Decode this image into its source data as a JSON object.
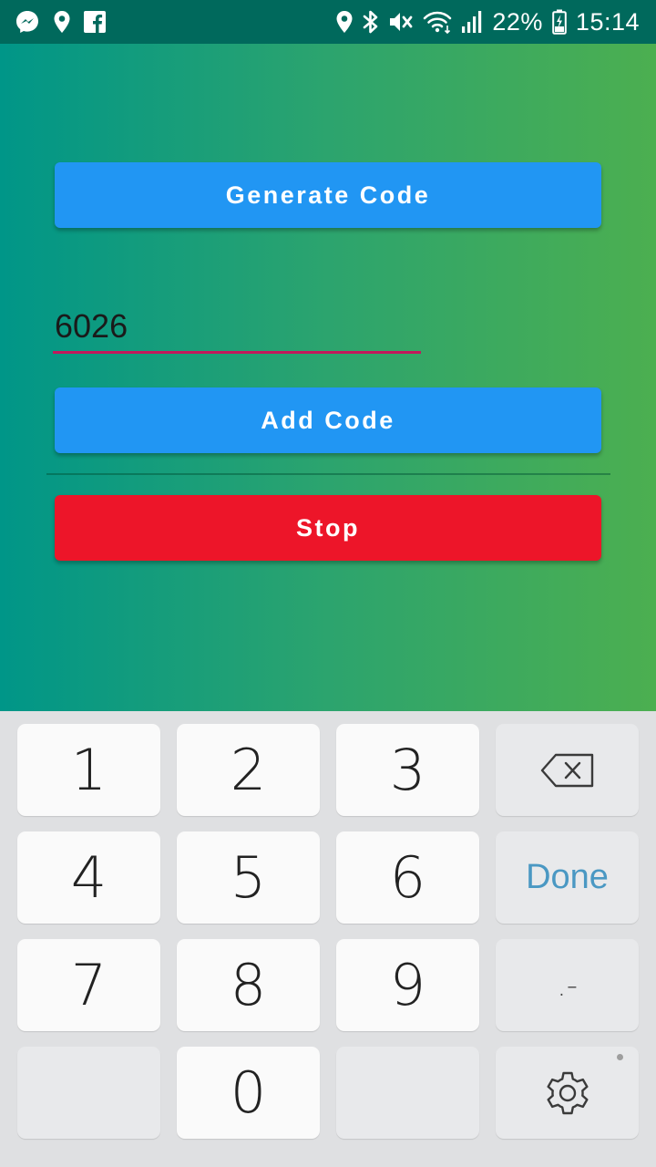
{
  "status_bar": {
    "left_icons": [
      "messenger-icon",
      "location-pin-icon",
      "facebook-icon"
    ],
    "right_icons": [
      "location-icon",
      "bluetooth-icon",
      "mute-icon",
      "wifi-icon",
      "signal-icon",
      "battery-icon"
    ],
    "battery_percent": "22%",
    "time": "15:14"
  },
  "app": {
    "generate_button_label": "Generate Code",
    "code_input_value": "6026",
    "add_button_label": "Add Code",
    "stop_button_label": "Stop",
    "colors": {
      "gradient_start": "#009688",
      "gradient_end": "#4caf50",
      "button_blue": "#2196f3",
      "button_red": "#ed1529",
      "input_underline": "#c2185b"
    }
  },
  "keyboard": {
    "keys": {
      "one": "1",
      "two": "2",
      "three": "3",
      "four": "4",
      "five": "5",
      "six": "6",
      "seven": "7",
      "eight": "8",
      "nine": "9",
      "zero": "0",
      "done": "Done",
      "symbols": ".-"
    },
    "icons": [
      "backspace-icon",
      "settings-icon"
    ]
  }
}
